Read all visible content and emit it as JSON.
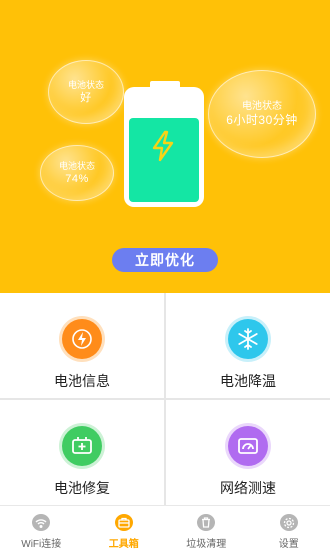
{
  "hero": {
    "background": "#ffc107",
    "bubbles": [
      {
        "title": "电池状态",
        "value": "好"
      },
      {
        "title": "电池状态",
        "value": "6小时30分钟"
      },
      {
        "title": "电池状态",
        "value": "74%"
      }
    ],
    "battery": {
      "level_percent": 74,
      "fill_color": "#14e6a4"
    },
    "optimize_button": "立即优化"
  },
  "tools": [
    {
      "label": "电池信息",
      "icon": "lightning-icon",
      "color": "#ff8c1a"
    },
    {
      "label": "电池降温",
      "icon": "snowflake-icon",
      "color": "#2ec7ec"
    },
    {
      "label": "电池修复",
      "icon": "battery-repair-icon",
      "color": "#40cc62"
    },
    {
      "label": "网络测速",
      "icon": "speedometer-icon",
      "color": "#b06bf0"
    }
  ],
  "tabbar": {
    "active_index": 1,
    "active_color": "#ffa800",
    "tabs": [
      {
        "label": "WiFi连接",
        "icon": "wifi-icon"
      },
      {
        "label": "工具箱",
        "icon": "toolbox-icon"
      },
      {
        "label": "垃圾清理",
        "icon": "trash-icon"
      },
      {
        "label": "设置",
        "icon": "gear-icon"
      }
    ]
  }
}
